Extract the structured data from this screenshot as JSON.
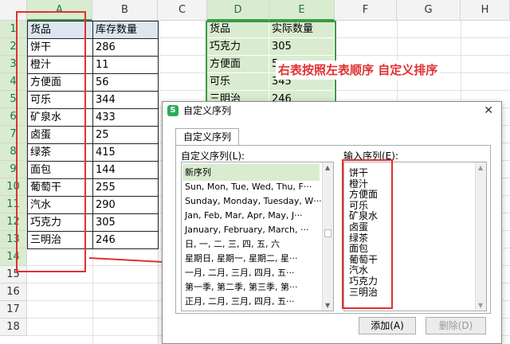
{
  "columns": [
    "A",
    "B",
    "C",
    "D",
    "E",
    "F",
    "G",
    "H"
  ],
  "rows": [
    "1",
    "2",
    "3",
    "4",
    "5",
    "6",
    "7",
    "8",
    "9",
    "10",
    "11",
    "12",
    "13",
    "14",
    "15",
    "16",
    "17",
    "18"
  ],
  "left_table": {
    "headers": [
      "货品",
      "库存数量"
    ],
    "rows": [
      [
        "饼干",
        "286"
      ],
      [
        "橙汁",
        "11"
      ],
      [
        "方便面",
        "56"
      ],
      [
        "可乐",
        "344"
      ],
      [
        "矿泉水",
        "433"
      ],
      [
        "卤蛋",
        "25"
      ],
      [
        "绿茶",
        "415"
      ],
      [
        "面包",
        "144"
      ],
      [
        "葡萄干",
        "255"
      ],
      [
        "汽水",
        "290"
      ],
      [
        "巧克力",
        "305"
      ],
      [
        "三明治",
        "246"
      ]
    ]
  },
  "right_table": {
    "headers": [
      "货品",
      "实际数量"
    ],
    "rows": [
      [
        "巧克力",
        "305"
      ],
      [
        "方便面",
        "5"
      ],
      [
        "可乐",
        "345"
      ],
      [
        "三明治",
        "246"
      ]
    ]
  },
  "annotation": "右表按照左表顺序 自定义排序",
  "dialog": {
    "icon_letter": "S",
    "title": "自定义序列",
    "close": "✕",
    "tab": "自定义序列",
    "list_label": "自定义序列(L):",
    "input_label": "输入序列(E):",
    "list_items": [
      "新序列",
      "Sun, Mon, Tue, Wed, Thu, F···",
      "Sunday, Monday, Tuesday, W···",
      "Jan, Feb, Mar, Apr, May, J···",
      "January, February, March, ···",
      "日, 一, 二, 三, 四, 五, 六",
      "星期日, 星期一, 星期二, 星···",
      "一月, 二月, 三月, 四月, 五···",
      "第一季, 第二季, 第三季, 第···",
      "正月, 二月, 三月, 四月, 五···"
    ],
    "input_items": [
      "饼干",
      "橙汁",
      "方便面",
      "可乐",
      "矿泉水",
      "卤蛋",
      "绿茶",
      "面包",
      "葡萄干",
      "汽水",
      "巧克力",
      "三明治"
    ],
    "add_button": "添加(A)",
    "delete_button": "删除(D)"
  },
  "colors": {
    "accent": "#217346",
    "red": "#e03030",
    "header_fill": "#dce6f1",
    "selected_fill": "#d9ecd0"
  }
}
